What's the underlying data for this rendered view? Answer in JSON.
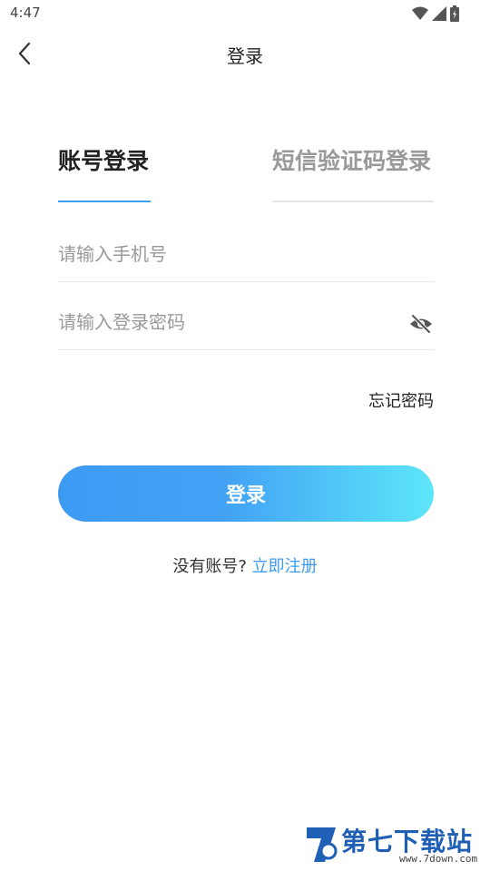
{
  "status_bar": {
    "time": "4:47",
    "icons": [
      "wifi-icon",
      "signal-icon",
      "battery-icon"
    ]
  },
  "header": {
    "title": "登录",
    "back_icon": "chevron-left-icon"
  },
  "tabs": [
    {
      "label": "账号登录",
      "active": true
    },
    {
      "label": "短信验证码登录",
      "active": false
    }
  ],
  "form": {
    "phone_placeholder": "请输入手机号",
    "phone_value": "",
    "password_placeholder": "请输入登录密码",
    "password_value": "",
    "visibility_icon": "eye-off-icon",
    "forgot_label": "忘记密码",
    "login_label": "登录"
  },
  "register": {
    "prompt": "没有账号?",
    "link": "立即注册"
  },
  "colors": {
    "accent": "#3d9cf2",
    "button_gradient_start": "#3d9af3",
    "button_gradient_end": "#5de6f9",
    "inactive_tab": "#999999",
    "divider": "#e6e6e6"
  },
  "watermark": {
    "text": "第七下载站",
    "url": "www.7down.com"
  }
}
